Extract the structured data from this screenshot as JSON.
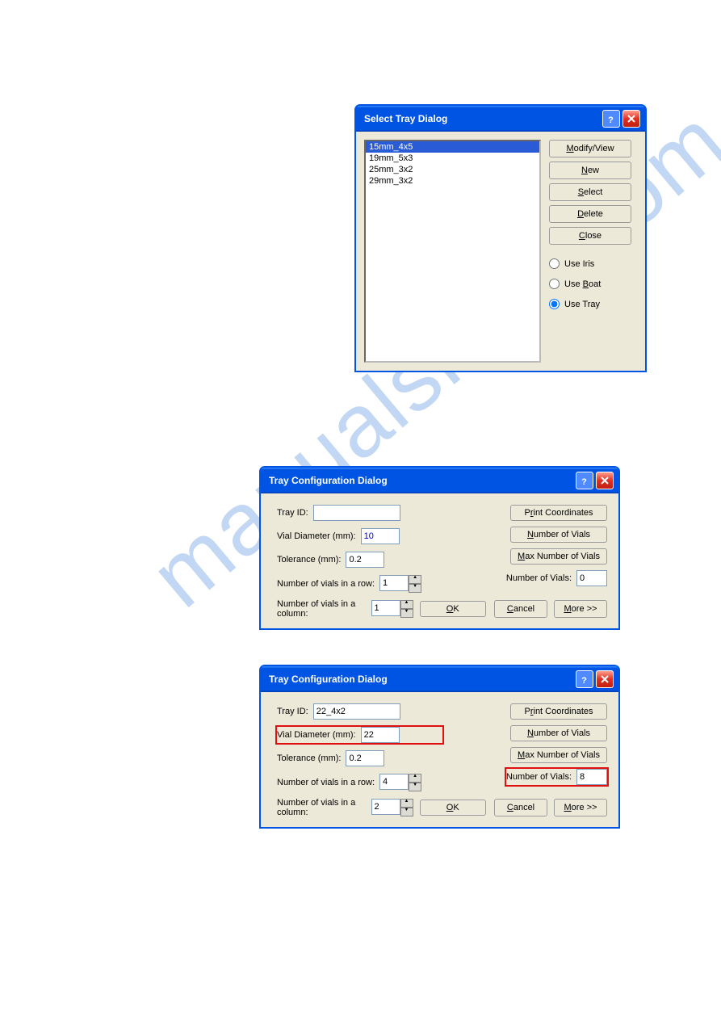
{
  "watermark": "manualshive.com",
  "dialog1": {
    "title": "Select Tray Dialog",
    "items": [
      "15mm_4x5",
      "19mm_5x3",
      "25mm_3x2",
      "29mm_3x2"
    ],
    "selected_index": 0,
    "buttons": {
      "modify_view": "Modify/View",
      "new": "New",
      "select": "Select",
      "delete": "Delete",
      "close": "Close"
    },
    "radios": {
      "use_iris": "Use Iris",
      "use_boat": "Use Boat",
      "use_tray": "Use Tray",
      "selected": "use_tray"
    }
  },
  "dialog2": {
    "title": "Tray Configuration Dialog",
    "labels": {
      "tray_id": "Tray ID:",
      "vial_diameter": "Vial Diameter (mm):",
      "tolerance": "Tolerance (mm):",
      "vials_row": "Number of vials in a row:",
      "vials_col": "Number of vials in a column:",
      "num_vials": "Number of Vials:"
    },
    "values": {
      "tray_id": "",
      "vial_diameter": "10",
      "tolerance": "0.2",
      "vials_row": "1",
      "vials_col": "1",
      "num_vials": "0"
    },
    "buttons": {
      "print_coords": "Print Coordinates",
      "num_vials_btn": "Number of Vials",
      "max_num_vials": "Max Number of Vials",
      "ok": "OK",
      "cancel": "Cancel",
      "more": "More >>"
    }
  },
  "dialog3": {
    "title": "Tray Configuration Dialog",
    "labels": {
      "tray_id": "Tray ID:",
      "vial_diameter": "Vial Diameter (mm):",
      "tolerance": "Tolerance (mm):",
      "vials_row": "Number of vials in a row:",
      "vials_col": "Number of vials in a column:",
      "num_vials": "Number of Vials:"
    },
    "values": {
      "tray_id": "22_4x2",
      "vial_diameter": "22",
      "tolerance": "0.2",
      "vials_row": "4",
      "vials_col": "2",
      "num_vials": "8"
    },
    "buttons": {
      "print_coords": "Print Coordinates",
      "num_vials_btn": "Number of Vials",
      "max_num_vials": "Max Number of Vials",
      "ok": "OK",
      "cancel": "Cancel",
      "more": "More >>"
    }
  }
}
